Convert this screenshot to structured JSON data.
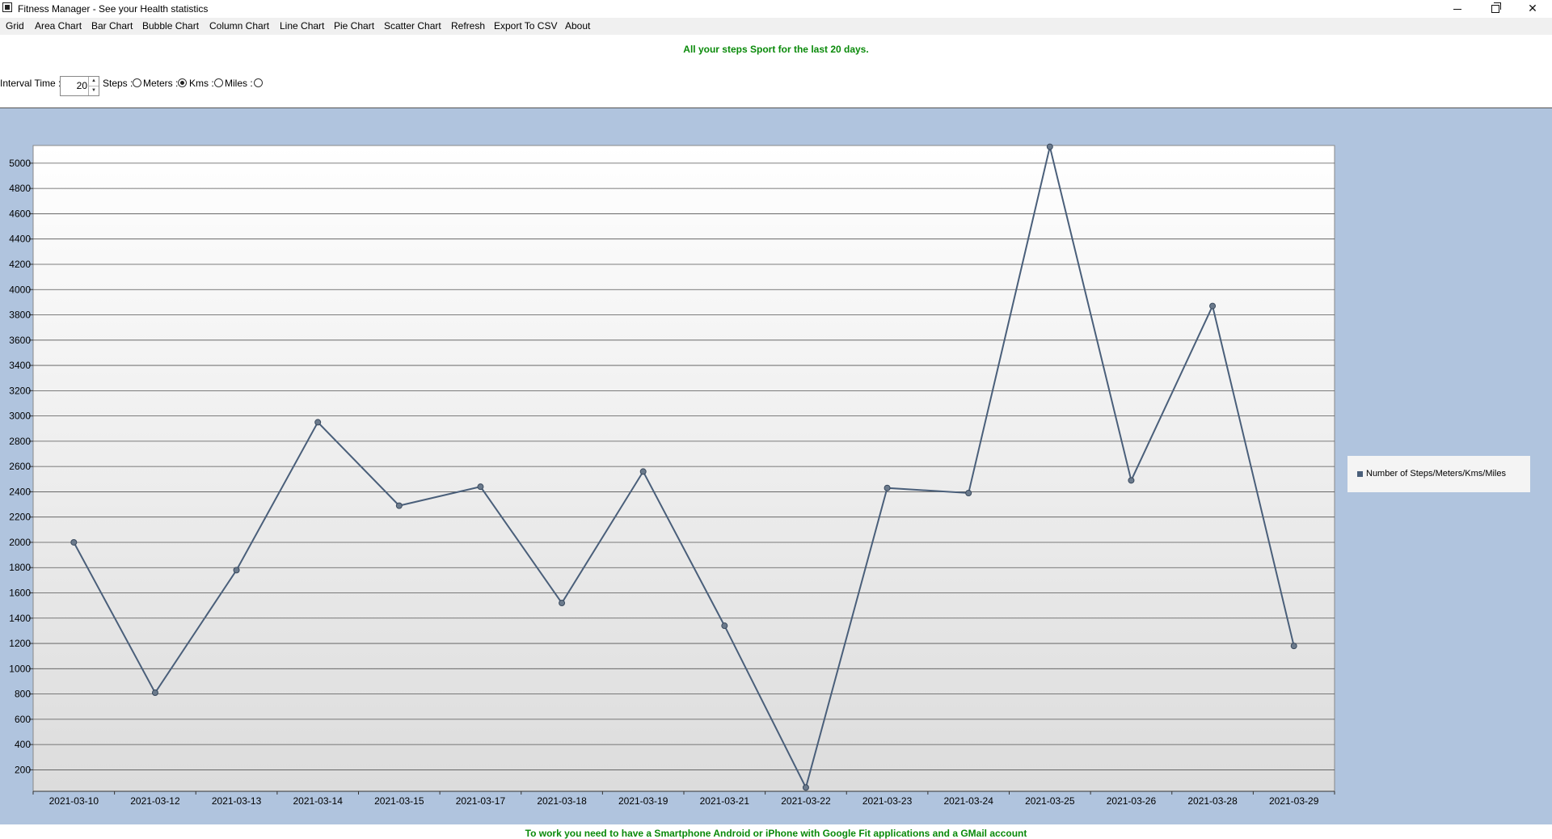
{
  "window": {
    "title": "Fitness Manager - See your Health statistics"
  },
  "menu": [
    "Grid",
    "Area Chart",
    "Bar Chart",
    "Bubble Chart",
    "Column Chart",
    "Line Chart",
    "Pie Chart",
    "Scatter Chart",
    "Refresh",
    "Export To CSV",
    "About"
  ],
  "header_text": "All your steps Sport for the last 20 days.",
  "controls": {
    "interval_label": "Interval Time :",
    "interval_value": "20",
    "units": [
      {
        "label": "Steps :",
        "checked": false
      },
      {
        "label": "Meters :",
        "checked": true
      },
      {
        "label": "Kms :",
        "checked": false
      },
      {
        "label": "Miles :",
        "checked": false
      }
    ]
  },
  "chart_data": {
    "type": "line",
    "categories": [
      "2021-03-10",
      "2021-03-12",
      "2021-03-13",
      "2021-03-14",
      "2021-03-15",
      "2021-03-17",
      "2021-03-18",
      "2021-03-19",
      "2021-03-21",
      "2021-03-22",
      "2021-03-23",
      "2021-03-24",
      "2021-03-25",
      "2021-03-26",
      "2021-03-28",
      "2021-03-29"
    ],
    "series": [
      {
        "name": "Number of Steps/Meters/Kms/Miles",
        "values": [
          2000,
          810,
          1780,
          2950,
          2290,
          2440,
          1520,
          2560,
          1340,
          60,
          2430,
          2390,
          5130,
          2490,
          3870,
          1180
        ]
      }
    ],
    "yticks": [
      200,
      400,
      600,
      800,
      1000,
      1200,
      1400,
      1600,
      1800,
      2000,
      2200,
      2400,
      2600,
      2800,
      3000,
      3200,
      3400,
      3600,
      3800,
      4000,
      4200,
      4400,
      4600,
      4800,
      5000
    ],
    "ylim": [
      30,
      5140
    ],
    "grid": true,
    "legend_position": "right",
    "line_color": "#4a5f7a"
  },
  "footer_text": "To work you need to have a Smartphone Android or iPhone with Google Fit applications and a GMail account"
}
